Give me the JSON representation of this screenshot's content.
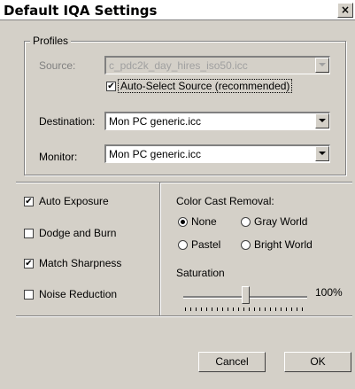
{
  "window": {
    "title": "Default IQA Settings",
    "close_glyph": "×"
  },
  "profiles": {
    "group_label": "Profiles",
    "source": {
      "label": "Source:",
      "value": "c_pdc2k_day_hires_iso50.icc",
      "enabled": false
    },
    "auto_select": {
      "label": "Auto-Select Source (recommended)",
      "checked": true
    },
    "destination": {
      "label": "Destination:",
      "value": "Mon PC generic.icc"
    },
    "monitor": {
      "label": "Monitor:",
      "value": "Mon PC generic.icc"
    }
  },
  "options": {
    "auto_exposure": {
      "label": "Auto Exposure",
      "checked": true
    },
    "dodge_burn": {
      "label": "Dodge and Burn",
      "checked": false
    },
    "match_sharpness": {
      "label": "Match Sharpness",
      "checked": true
    },
    "noise_reduction": {
      "label": "Noise Reduction",
      "checked": false
    }
  },
  "color_cast": {
    "label": "Color Cast Removal:",
    "options": {
      "none": "None",
      "gray_world": "Gray World",
      "pastel": "Pastel",
      "bright_world": "Bright World"
    },
    "selected": "none"
  },
  "saturation": {
    "label": "Saturation",
    "value_text": "100%",
    "level": 0.5
  },
  "buttons": {
    "cancel": "Cancel",
    "ok": "OK"
  },
  "colors": {
    "face": "#d4d0c8",
    "shadow": "#808080",
    "highlight": "#ffffff"
  }
}
